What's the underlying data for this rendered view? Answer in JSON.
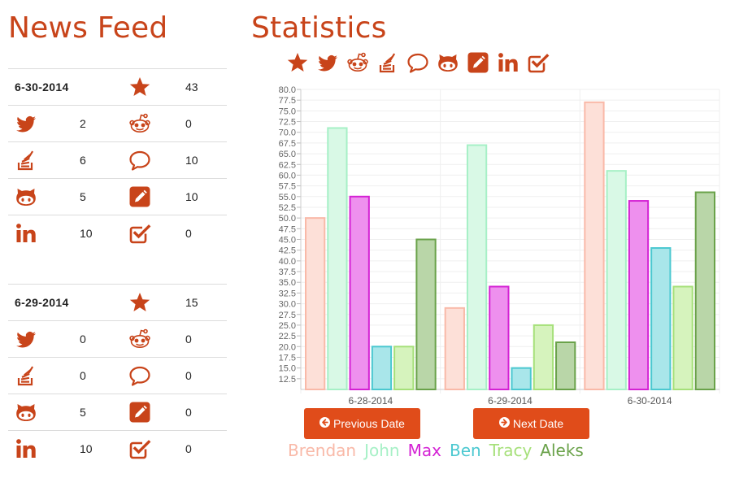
{
  "news_feed": {
    "title": "News Feed",
    "days": [
      {
        "date": "6-30-2014",
        "star_count": "43",
        "rows": [
          {
            "left_icon": "twitter-icon",
            "left_value": "2",
            "right_icon": "reddit-icon",
            "right_value": "0"
          },
          {
            "left_icon": "stackoverflow-icon",
            "left_value": "6",
            "right_icon": "comment-icon",
            "right_value": "10"
          },
          {
            "left_icon": "github-icon",
            "left_value": "5",
            "right_icon": "edit-icon",
            "right_value": "10"
          },
          {
            "left_icon": "linkedin-icon",
            "left_value": "10",
            "right_icon": "check-square-icon",
            "right_value": "0"
          }
        ]
      },
      {
        "date": "6-29-2014",
        "star_count": "15",
        "rows": [
          {
            "left_icon": "twitter-icon",
            "left_value": "0",
            "right_icon": "reddit-icon",
            "right_value": "0"
          },
          {
            "left_icon": "stackoverflow-icon",
            "left_value": "0",
            "right_icon": "comment-icon",
            "right_value": "0"
          },
          {
            "left_icon": "github-icon",
            "left_value": "5",
            "right_icon": "edit-icon",
            "right_value": "0"
          },
          {
            "left_icon": "linkedin-icon",
            "left_value": "10",
            "right_icon": "check-square-icon",
            "right_value": "0"
          }
        ]
      }
    ]
  },
  "statistics": {
    "title": "Statistics",
    "filter_icons": [
      "star-icon",
      "twitter-icon",
      "reddit-icon",
      "stackoverflow-icon",
      "comment-icon",
      "github-icon",
      "edit-icon",
      "linkedin-icon",
      "check-square-icon"
    ],
    "prev_label": "Previous Date",
    "next_label": "Next Date"
  },
  "colors": {
    "accent": "#c8441a",
    "button": "#e04c1a"
  },
  "chart_data": {
    "type": "bar",
    "categories": [
      "6-28-2014",
      "6-29-2014",
      "6-30-2014"
    ],
    "series": [
      {
        "name": "Brendan",
        "color": "#f9b9a8",
        "fill": "#fde0d8",
        "values": [
          50,
          29,
          77
        ]
      },
      {
        "name": "John",
        "color": "#a6f0c6",
        "fill": "#d9f9e6",
        "values": [
          71,
          67,
          61
        ]
      },
      {
        "name": "Max",
        "color": "#d422d4",
        "fill": "#ee90ee",
        "values": [
          55,
          34,
          54
        ]
      },
      {
        "name": "Ben",
        "color": "#4bc8d0",
        "fill": "#a9e6ea",
        "values": [
          20,
          15,
          43
        ]
      },
      {
        "name": "Tracy",
        "color": "#a6e07a",
        "fill": "#d6f3bd",
        "values": [
          20,
          25,
          34
        ]
      },
      {
        "name": "Aleks",
        "color": "#6aa24a",
        "fill": "#b9d6a8",
        "values": [
          45,
          21,
          56
        ]
      }
    ],
    "ylim": [
      10,
      80
    ],
    "ytick_step": 2.5,
    "ytick_min": 12.5,
    "grid": true,
    "legend": "bottom"
  }
}
